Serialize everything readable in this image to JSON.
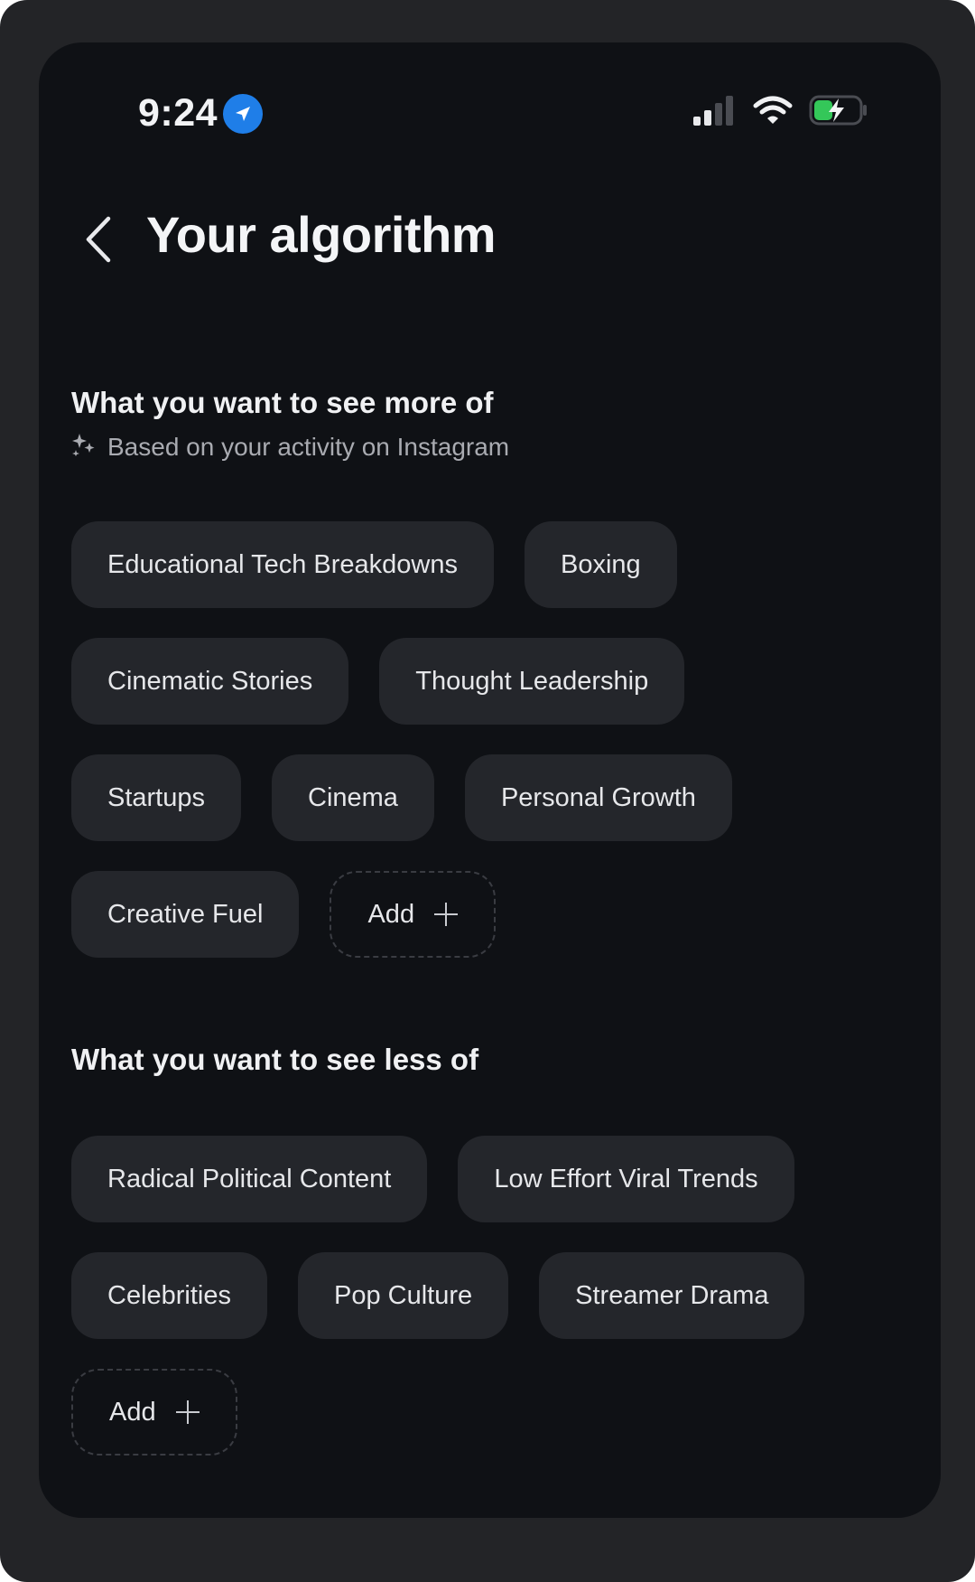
{
  "status_bar": {
    "time": "9:24",
    "icons": [
      "location-arrow-icon",
      "cellular-signal-icon",
      "wifi-icon",
      "battery-charging-icon"
    ]
  },
  "header": {
    "back_icon": "chevron-left-icon",
    "title": "Your algorithm"
  },
  "more_section": {
    "title": "What you want to see more of",
    "subtitle": "Based on your activity on Instagram",
    "subtitle_icon": "sparkles-icon",
    "chips": [
      "Educational Tech Breakdowns",
      "Boxing",
      "Cinematic Stories",
      "Thought Leadership",
      "Startups",
      "Cinema",
      "Personal Growth",
      "Creative Fuel"
    ],
    "add_label": "Add"
  },
  "less_section": {
    "title": "What you want to see less of",
    "chips": [
      "Radical Political Content",
      "Low Effort Viral Trends",
      "Celebrities",
      "Pop Culture",
      "Streamer Drama"
    ],
    "add_label": "Add"
  },
  "colors": {
    "background": "#0f1115",
    "chip": "#24262b",
    "text": "#f4f5f7",
    "accent_location": "#1f7ee8",
    "battery_green": "#34c759"
  }
}
